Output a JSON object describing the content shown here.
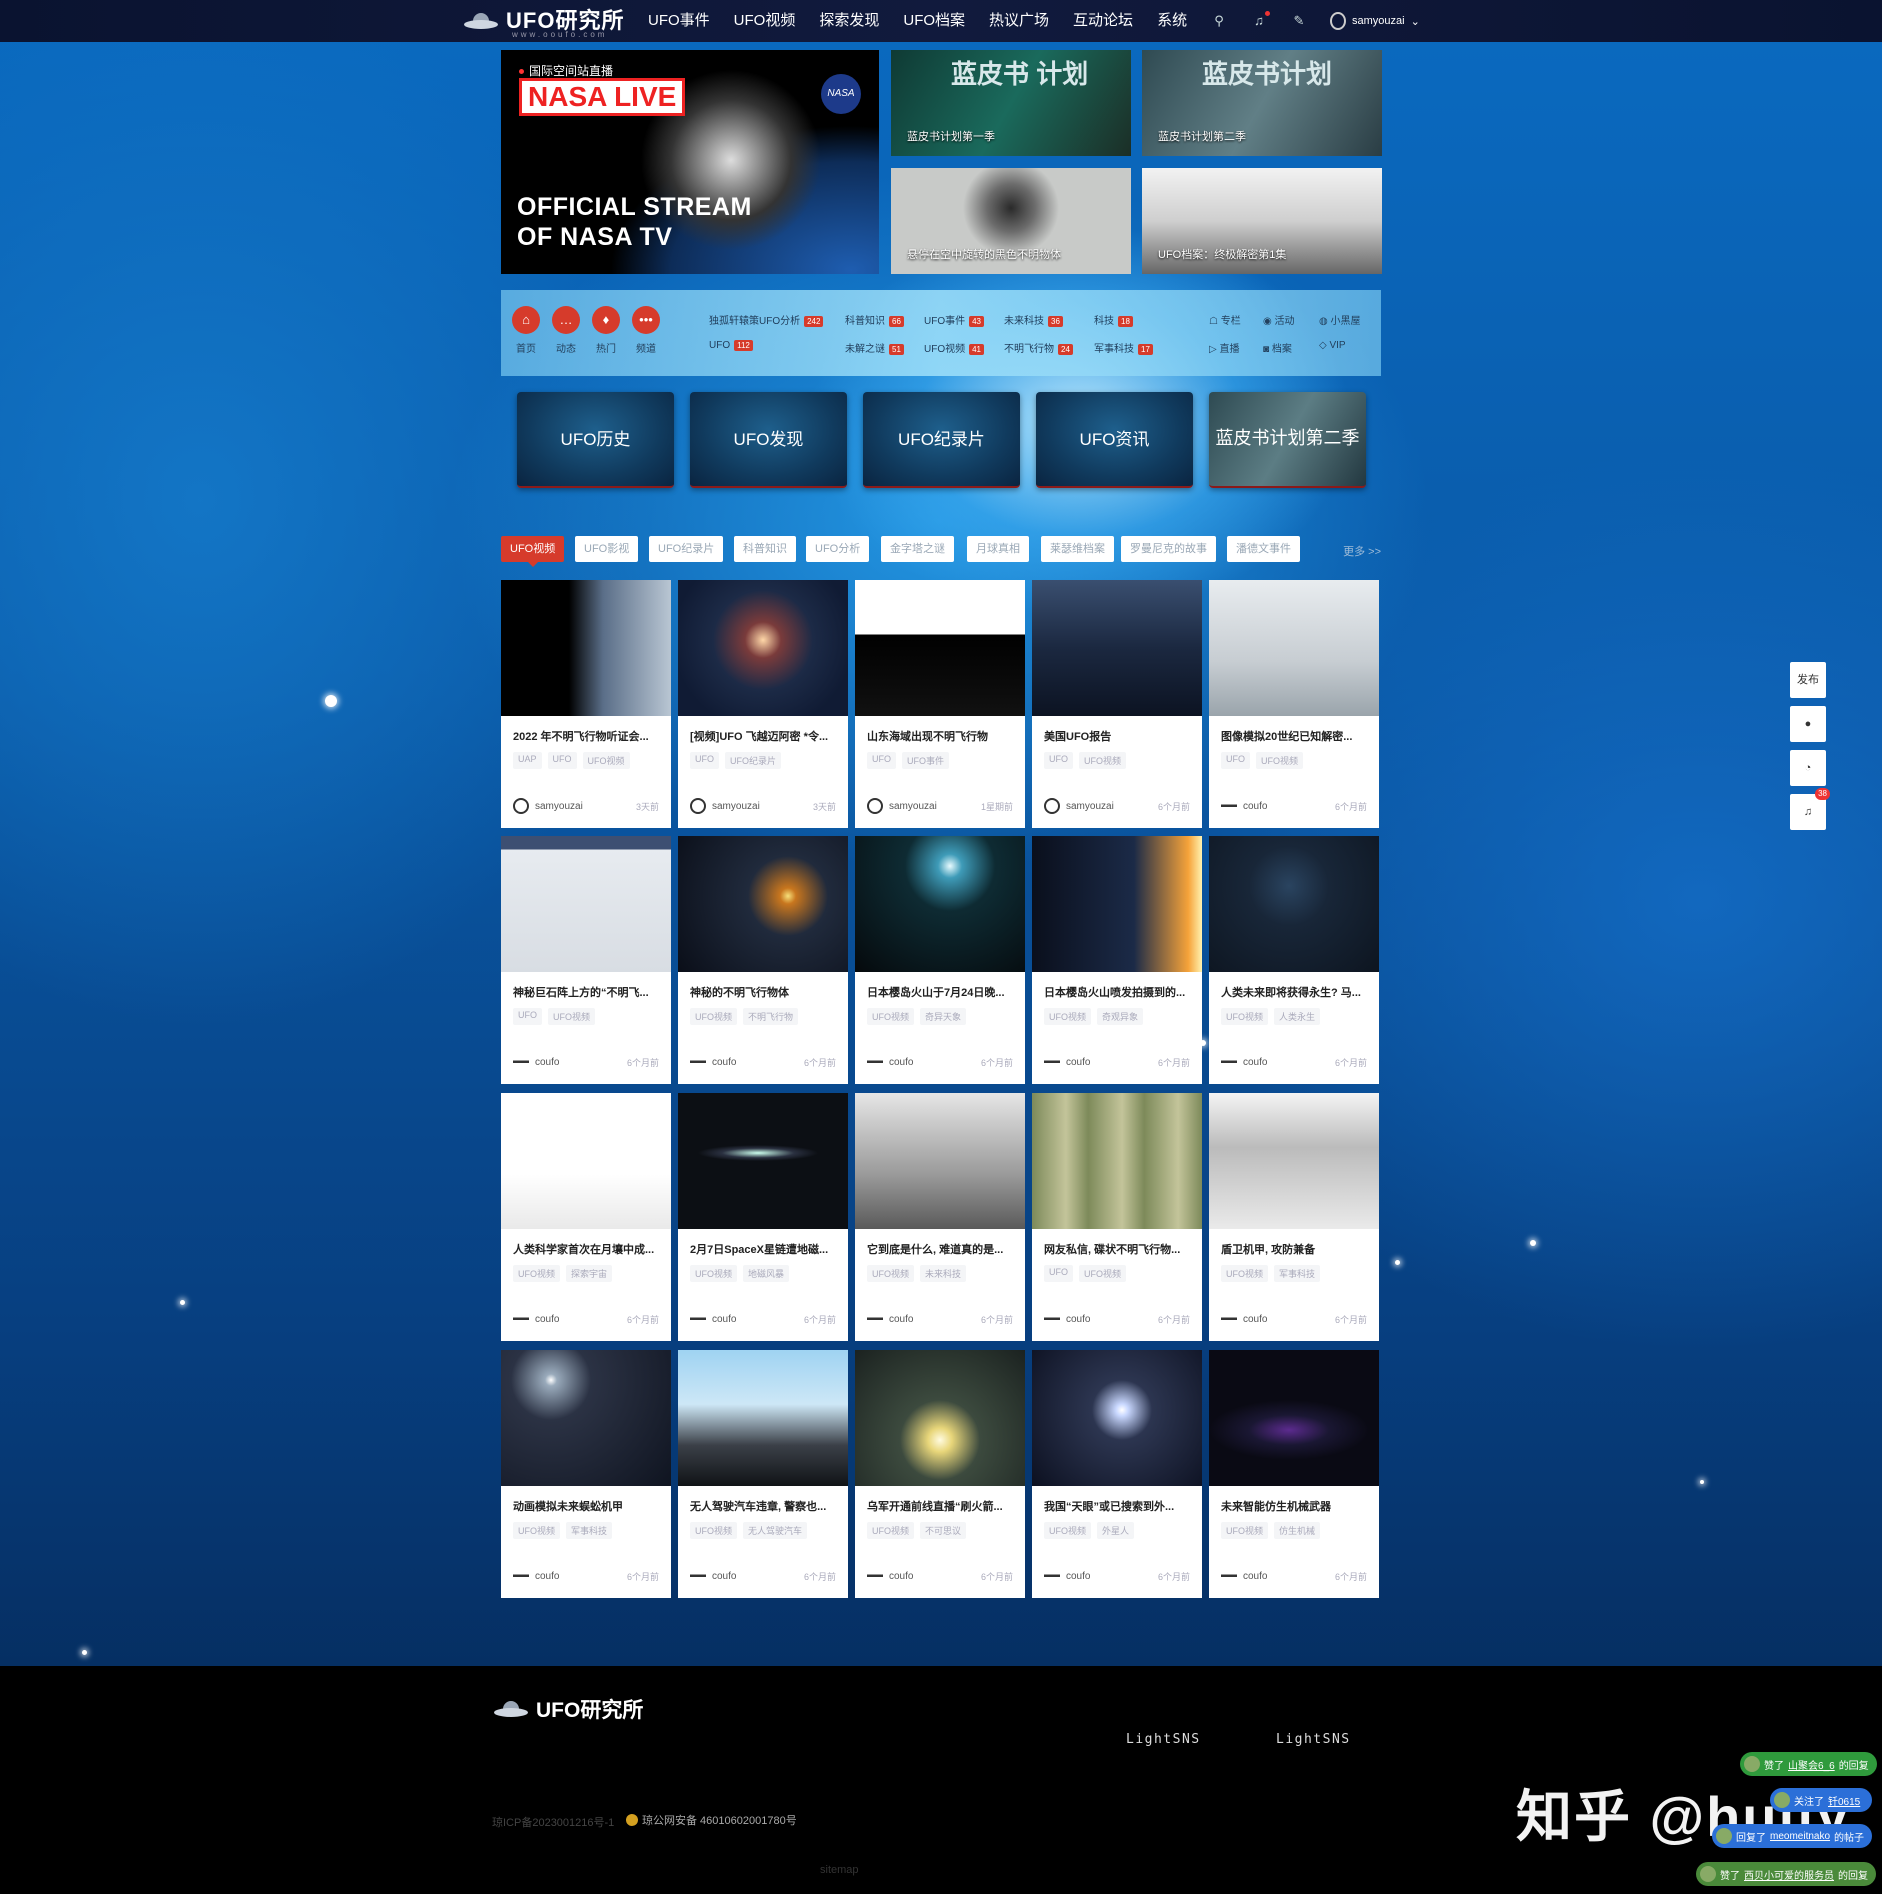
{
  "site": {
    "name": "UFO研究所",
    "domain_sub": "www.ooufo.com"
  },
  "nav": {
    "links": [
      "UFO事件",
      "UFO视频",
      "探索发现",
      "UFO档案",
      "热议广场",
      "互动论坛",
      "系统"
    ],
    "user_name": "samyouzai"
  },
  "hero": {
    "main": {
      "tag": "国际空间站直播",
      "live": "NASA LIVE",
      "line1": "OFFICIAL STREAM",
      "line2": "OF NASA TV",
      "badge": "NASA"
    },
    "items": [
      {
        "overlay": "蓝皮书 计划",
        "caption": "蓝皮书计划第一季"
      },
      {
        "overlay": "蓝皮书计划",
        "caption": "蓝皮书计划第二季"
      },
      {
        "caption": "悬停在空中旋转的黑色不明物体"
      },
      {
        "caption": "UFO档案：终极解密第1集"
      }
    ]
  },
  "quicknav": {
    "circles": [
      {
        "label": "首页",
        "icon": "home-icon",
        "glyph": "⌂"
      },
      {
        "label": "动态",
        "icon": "chat-icon",
        "glyph": "…"
      },
      {
        "label": "热门",
        "icon": "fire-icon",
        "glyph": "♦"
      },
      {
        "label": "频道",
        "icon": "more-icon",
        "glyph": "•••"
      }
    ],
    "categories": [
      {
        "name": "独孤轩辕策UFO分析",
        "count": "242"
      },
      {
        "name": "科普知识",
        "count": "66"
      },
      {
        "name": "UFO事件",
        "count": "43"
      },
      {
        "name": "未来科技",
        "count": "36"
      },
      {
        "name": "科技",
        "count": "18"
      },
      {
        "name": "UFO",
        "count": "112"
      },
      {
        "name": "未解之谜",
        "count": "51"
      },
      {
        "name": "UFO视频",
        "count": "41"
      },
      {
        "name": "不明飞行物",
        "count": "24"
      },
      {
        "name": "军事科技",
        "count": "17"
      }
    ],
    "links": [
      "专栏",
      "活动",
      "小黑屋",
      "直播",
      "档案",
      "VIP"
    ]
  },
  "big_buttons": [
    "UFO历史",
    "UFO发现",
    "UFO纪录片",
    "UFO资讯",
    "蓝皮书计划第二季"
  ],
  "tabs": {
    "items": [
      "UFO视频",
      "UFO影视",
      "UFO纪录片",
      "科普知识",
      "UFO分析",
      "金字塔之谜",
      "月球真相",
      "莱瑟维档案",
      "罗曼尼克的故事",
      "潘德文事件"
    ],
    "more": "更多 >>"
  },
  "cards": [
    {
      "title": "2022 年不明飞行物听证会...",
      "tags": [
        "UAP",
        "UFO",
        "UFO视频"
      ],
      "author": "samyouzai",
      "time": "3天前"
    },
    {
      "title": "[视频]UFO 飞越迈阿密 *令...",
      "tags": [
        "UFO",
        "UFO纪录片"
      ],
      "author": "samyouzai",
      "time": "3天前"
    },
    {
      "title": "山东海域出现不明飞行物",
      "tags": [
        "UFO",
        "UFO事件"
      ],
      "author": "samyouzai",
      "time": "1星期前"
    },
    {
      "title": "美国UFO报告",
      "tags": [
        "UFO",
        "UFO视频"
      ],
      "author": "samyouzai",
      "time": "6个月前"
    },
    {
      "title": "图像模拟20世纪已知解密...",
      "tags": [
        "UFO",
        "UFO视频"
      ],
      "author": "coufo",
      "time": "6个月前"
    },
    {
      "title": "神秘巨石阵上方的“不明飞...",
      "tags": [
        "UFO",
        "UFO视频"
      ],
      "author": "coufo",
      "time": "6个月前"
    },
    {
      "title": "神秘的不明飞行物体",
      "tags": [
        "UFO视频",
        "不明飞行物"
      ],
      "author": "coufo",
      "time": "6个月前"
    },
    {
      "title": "日本樱岛火山于7月24日晚...",
      "tags": [
        "UFO视频",
        "奇异天象"
      ],
      "author": "coufo",
      "time": "6个月前"
    },
    {
      "title": "日本樱岛火山喷发拍摄到的...",
      "tags": [
        "UFO视频",
        "奇观异象"
      ],
      "author": "coufo",
      "time": "6个月前"
    },
    {
      "title": "人类未来即将获得永生? 马...",
      "tags": [
        "UFO视频",
        "人类永生"
      ],
      "author": "coufo",
      "time": "6个月前"
    },
    {
      "title": "人类科学家首次在月壤中成...",
      "tags": [
        "UFO视频",
        "探索宇宙"
      ],
      "author": "coufo",
      "time": "6个月前"
    },
    {
      "title": "2月7日SpaceX星链遭地磁...",
      "tags": [
        "UFO视频",
        "地磁风暴"
      ],
      "author": "coufo",
      "time": "6个月前"
    },
    {
      "title": "它到底是什么, 难道真的是...",
      "tags": [
        "UFO视频",
        "未来科技"
      ],
      "author": "coufo",
      "time": "6个月前"
    },
    {
      "title": "网友私信, 碟状不明飞行物...",
      "tags": [
        "UFO",
        "UFO视频"
      ],
      "author": "coufo",
      "time": "6个月前"
    },
    {
      "title": "盾卫机甲, 攻防兼备",
      "tags": [
        "UFO视频",
        "军事科技"
      ],
      "author": "coufo",
      "time": "6个月前"
    },
    {
      "title": "动画模拟未来蜈蚣机甲",
      "tags": [
        "UFO视频",
        "军事科技"
      ],
      "author": "coufo",
      "time": "6个月前"
    },
    {
      "title": "无人驾驶汽车违章, 警察也...",
      "tags": [
        "UFO视频",
        "无人驾驶汽车"
      ],
      "author": "coufo",
      "time": "6个月前"
    },
    {
      "title": "乌军开通前线直播“刷火箭...",
      "tags": [
        "UFO视频",
        "不可思议"
      ],
      "author": "coufo",
      "time": "6个月前"
    },
    {
      "title": "我国“天眼”或已搜索到外...",
      "tags": [
        "UFO视频",
        "外星人"
      ],
      "author": "coufo",
      "time": "6个月前"
    },
    {
      "title": "未来智能仿生机械武器",
      "tags": [
        "UFO视频",
        "仿生机械"
      ],
      "author": "coufo",
      "time": "6个月前"
    }
  ],
  "side_tools": {
    "publish": "发布",
    "badge": "38"
  },
  "footer": {
    "links": [
      "LightSNS",
      "LightSNS"
    ],
    "icp": "琼ICP备2023001216号-1",
    "police": "琼公网安备 46010602001780号",
    "sitemap": "sitemap"
  },
  "watermark": "知乎 @huify",
  "toasts": [
    {
      "text": "赞了",
      "link": "山聚会6_6",
      "tail": "的回复"
    },
    {
      "text": "关注了",
      "link": "钎0615",
      "tail": ""
    },
    {
      "text": "回复了",
      "link": "meomeitnako",
      "tail": "的帖子"
    },
    {
      "text": "赞了",
      "link": "西贝小可爱的服务员",
      "tail": "的回复"
    }
  ],
  "colors": {
    "accent": "#d63b2b",
    "nav_bg": "#0a1330",
    "footer_bg": "#000000"
  }
}
